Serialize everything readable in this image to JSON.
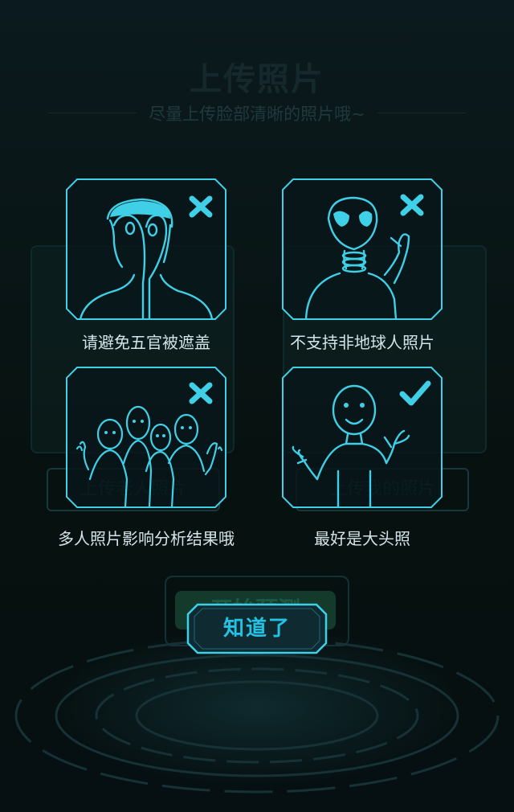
{
  "background": {
    "title": "上传照片",
    "subtitle": "尽量上传脸部清晰的照片哦~",
    "left_button": "上传老人照片",
    "right_button": "上传我的照片",
    "start_button": "开始预测"
  },
  "modal": {
    "tips": [
      {
        "caption": "请避免五官被遮盖",
        "mark": "cross-icon"
      },
      {
        "caption": "不支持非地球人照片",
        "mark": "cross-icon"
      },
      {
        "caption": "多人照片影响分析结果哦",
        "mark": "cross-icon"
      },
      {
        "caption": "最好是大头照",
        "mark": "check-icon"
      }
    ],
    "ok_button": "知道了"
  },
  "colors": {
    "accent": "#22c3e4",
    "card_border": "#3fd0e8",
    "caption": "#d3e4ea",
    "background": "#0a1418"
  }
}
